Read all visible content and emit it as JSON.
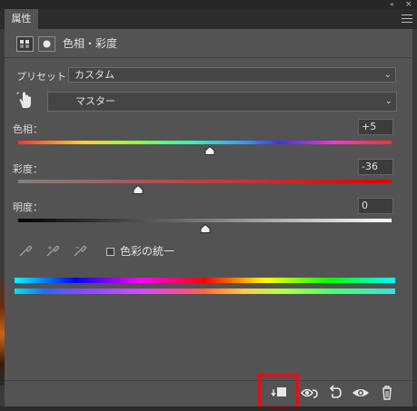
{
  "window": {
    "collapse_glyph": "«",
    "close_glyph": "×"
  },
  "tab": {
    "label": "属性"
  },
  "panel_menu_icon": "hamburger-menu-icon",
  "header": {
    "title": "色相・彩度",
    "adjustment_icon": "hue-saturation-adjustment-icon",
    "mask_icon": "layer-mask-icon"
  },
  "preset": {
    "label": "プリセット：",
    "value": "カスタム"
  },
  "channel": {
    "value": "マスター"
  },
  "hue": {
    "label": "色相：",
    "value": "+5",
    "range": [
      -180,
      180
    ]
  },
  "saturation": {
    "label": "彩度：",
    "value": "-36",
    "range": [
      -100,
      100
    ]
  },
  "lightness": {
    "label": "明度：",
    "value": "0",
    "range": [
      -100,
      100
    ]
  },
  "colorize": {
    "label": "色彩の統一",
    "checked": false
  },
  "colors": {
    "accent_highlight": "#e0101a",
    "panel_bg": "#535353"
  }
}
